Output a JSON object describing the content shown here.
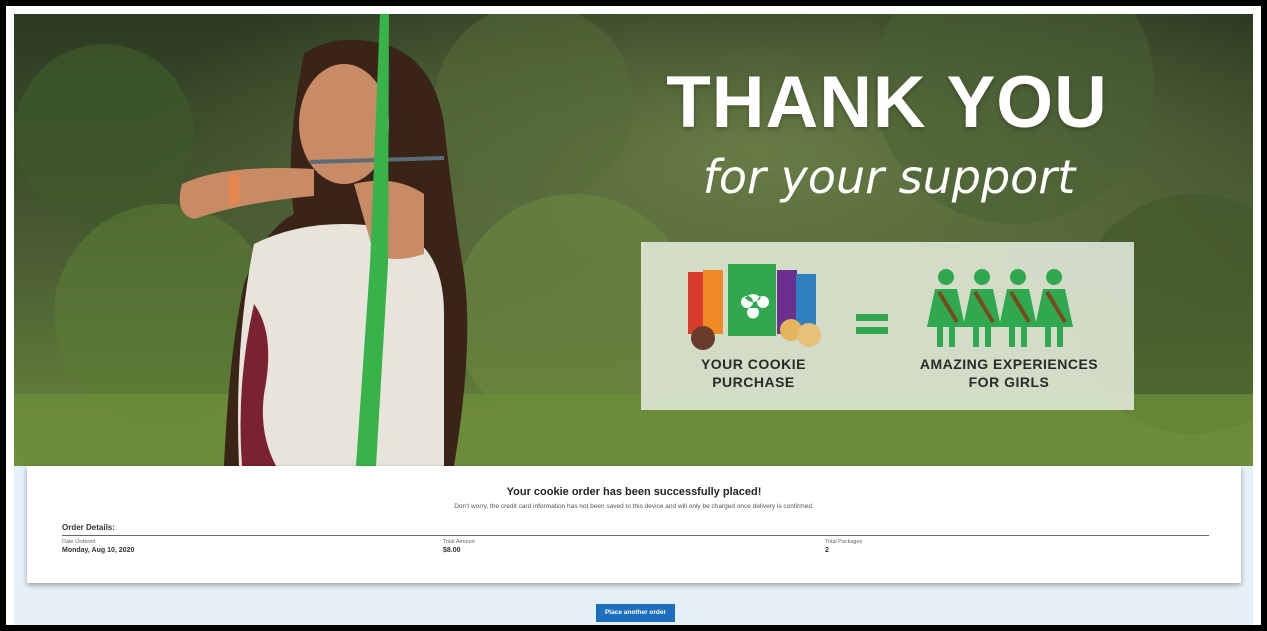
{
  "hero": {
    "headline": "THANK YOU",
    "subheadline": "for your support",
    "panel": {
      "left_caption_line1": "YOUR COOKIE",
      "left_caption_line2": "PURCHASE",
      "right_caption_line1": "AMAZING EXPERIENCES",
      "right_caption_line2": "FOR GIRLS",
      "equals": "="
    }
  },
  "confirmation": {
    "title": "Your cookie order has been successfully placed!",
    "note": "Don't worry, the credit card information has not been saved to this device and will only be charged once delivery is confirmed.",
    "details_heading": "Order Details:",
    "fields": [
      {
        "label": "Date Ordered",
        "value": "Monday, Aug 10, 2020"
      },
      {
        "label": "Total Amount",
        "value": "$8.00"
      },
      {
        "label": "Total Packages",
        "value": "2"
      }
    ]
  },
  "actions": {
    "place_another_order": "Place another order"
  },
  "colors": {
    "primary_button": "#1f6fbf",
    "page_background": "#e6f0f9",
    "girl_figure_green": "#2fa84f"
  }
}
